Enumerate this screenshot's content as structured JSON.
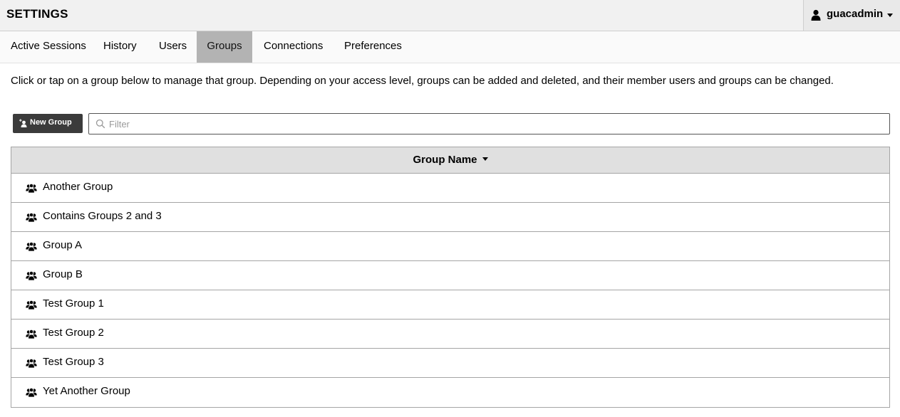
{
  "header": {
    "title": "SETTINGS",
    "user": {
      "name": "guacadmin",
      "icon": "user-icon"
    }
  },
  "tabs": [
    {
      "label": "Active Sessions",
      "active": false
    },
    {
      "label": "History",
      "active": false
    },
    {
      "label": "Users",
      "active": false
    },
    {
      "label": "Groups",
      "active": true
    },
    {
      "label": "Connections",
      "active": false
    },
    {
      "label": "Preferences",
      "active": false
    }
  ],
  "intro": "Click or tap on a group below to manage that group. Depending on your access level, groups can be added and deleted, and their member users and groups can be changed.",
  "toolbar": {
    "new_group_label": "New Group",
    "filter_placeholder": "Filter"
  },
  "table": {
    "column_header": "Group Name",
    "rows": [
      "Another Group",
      "Contains Groups 2 and 3",
      "Group A",
      "Group B",
      "Test Group 1",
      "Test Group 2",
      "Test Group 3",
      "Yet Another Group"
    ]
  },
  "colors": {
    "header_bg": "#f1f1f1",
    "active_tab_bg": "#b3b3b3",
    "button_bg": "#3b3b3b",
    "table_header_bg": "#e0e0e0"
  }
}
